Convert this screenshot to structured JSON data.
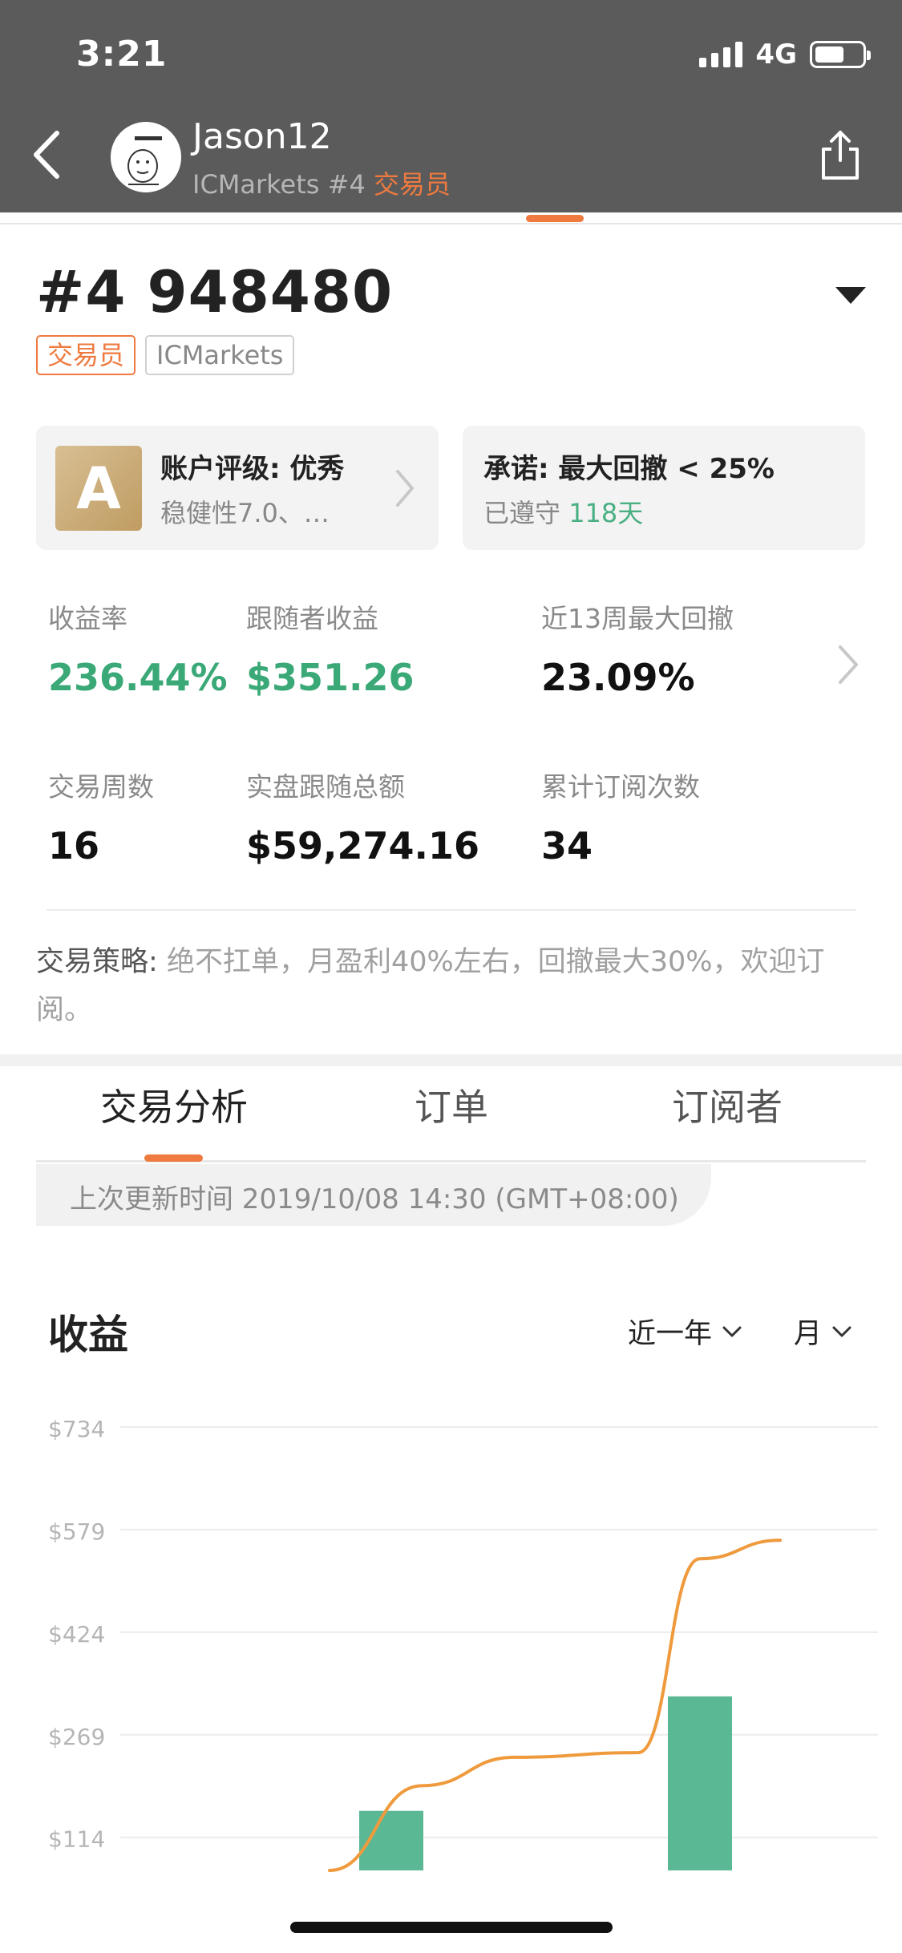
{
  "status_bar": {
    "time": "3:21",
    "network": "4G"
  },
  "header": {
    "user_name": "Jason12",
    "broker": "ICMarkets #4",
    "role": "交易员"
  },
  "account": {
    "title": "#4 948480",
    "tags": [
      "交易员",
      "ICMarkets"
    ]
  },
  "rating_card": {
    "grade": "A",
    "title": "账户评级: 优秀",
    "subtitle": "稳健性7.0、…"
  },
  "promise_card": {
    "title": "承诺: 最大回撤 < 25%",
    "subtitle_prefix": "已遵守 ",
    "days": "118天"
  },
  "stats": [
    {
      "label": "收益率",
      "value": "236.44%"
    },
    {
      "label": "跟随者收益",
      "value": "$351.26"
    },
    {
      "label": "近13周最大回撤",
      "value": "23.09%"
    },
    {
      "label": "交易周数",
      "value": "16"
    },
    {
      "label": "实盘跟随总额",
      "value": "$59,274.16"
    },
    {
      "label": "累计订阅次数",
      "value": "34"
    }
  ],
  "strategy": {
    "label": "交易策略:",
    "text": "绝不扛单，月盈利40%左右，回撤最大30%，欢迎订阅。"
  },
  "tabs": [
    "交易分析",
    "订单",
    "订阅者"
  ],
  "update_time": "上次更新时间 2019/10/08 14:30 (GMT+08:00)",
  "chart_section": {
    "title": "收益",
    "range_filter": "近一年",
    "period_filter": "月"
  },
  "chart_data": {
    "type": "bar",
    "title": "收益",
    "y_ticks": [
      "$734",
      "$579",
      "$424",
      "$269",
      "$114"
    ],
    "y_tick_values": [
      734,
      579,
      424,
      269,
      114
    ],
    "ylim": [
      64,
      734
    ],
    "bars": [
      {
        "slot": 5,
        "value": 154
      },
      {
        "slot": 10,
        "value": 327
      }
    ],
    "line": [
      {
        "slot": 4,
        "value": 64
      },
      {
        "slot": 5.5,
        "value": 192
      },
      {
        "slot": 7,
        "value": 235
      },
      {
        "slot": 9,
        "value": 242
      },
      {
        "slot": 10,
        "value": 535
      },
      {
        "slot": 11.3,
        "value": 563
      }
    ],
    "colors": {
      "bar": "#5bb895",
      "line": "#ef9a3c",
      "grid": "#ececec"
    }
  }
}
